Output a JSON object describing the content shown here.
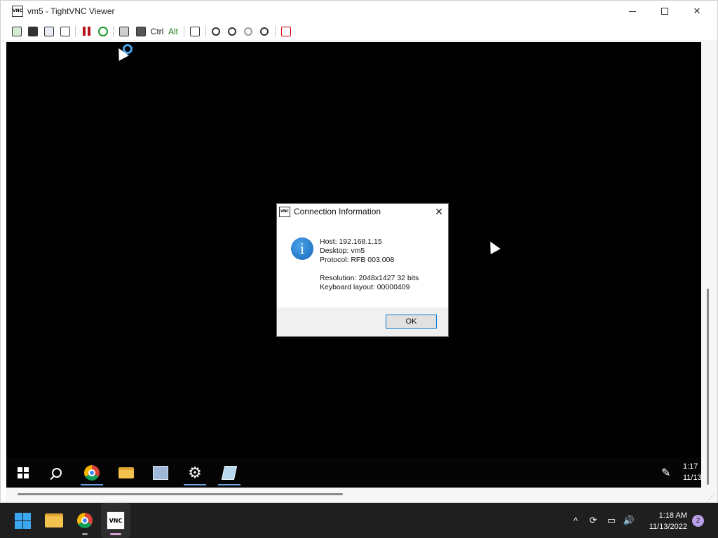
{
  "window": {
    "title": "vm5 - TightVNC Viewer",
    "app_icon_text": "VNC"
  },
  "toolbar": {
    "ctrl_label": "Ctrl",
    "alt_label": "Alt"
  },
  "dialog": {
    "title": "Connection Information",
    "icon_text": "VNC",
    "info_glyph": "i",
    "host": "Host: 192.168.1.15",
    "desktop": "Desktop: vm5",
    "protocol": "Protocol: RFB 003.008",
    "resolution": "Resolution: 2048x1427 32 bits",
    "keyboard": "Keyboard layout: 00000409",
    "ok_label": "OK",
    "close_glyph": "✕"
  },
  "remote_taskbar": {
    "clock_time": "1:17",
    "clock_date": "11/13"
  },
  "host_taskbar": {
    "clock_time": "1:18 AM",
    "clock_date": "11/13/2022",
    "notification_count": "2",
    "vnc_app_text": "VNC"
  },
  "colors": {
    "accent": "#0078d7",
    "host_taskbar_bg": "#1f1f1f",
    "remote_bg": "#000000"
  }
}
